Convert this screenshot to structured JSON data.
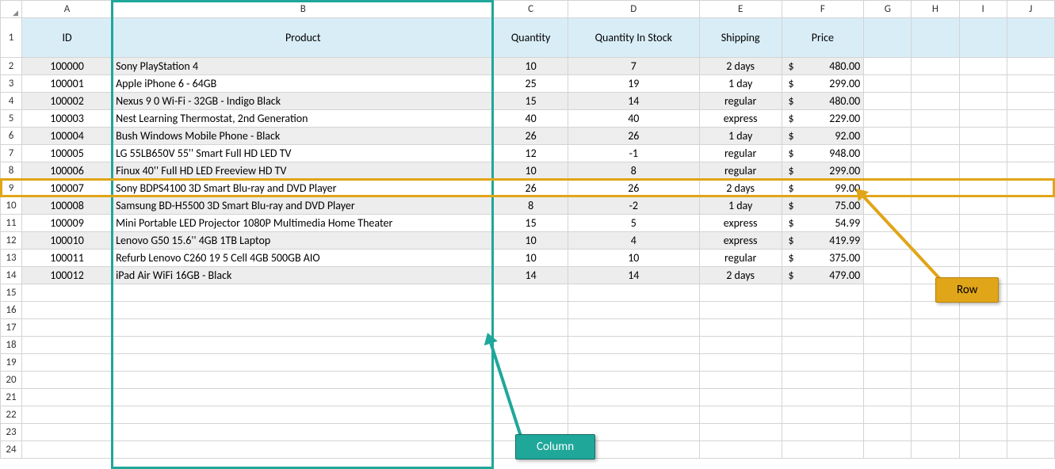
{
  "columns": [
    "A",
    "B",
    "C",
    "D",
    "E",
    "F",
    "G",
    "H",
    "I",
    "J"
  ],
  "col_widths": {
    "row": 26,
    "A": 110,
    "B": 464,
    "C": 90,
    "D": 160,
    "E": 100,
    "F": 100,
    "G": 58,
    "H": 58,
    "I": 58,
    "J": 58
  },
  "headers": {
    "A": "ID",
    "B": "Product",
    "C": "Quantity",
    "D": "Quantity In Stock",
    "E": "Shipping",
    "F": "Price"
  },
  "currency": "$",
  "rows": [
    {
      "A": "100000",
      "B": "Sony PlayStation 4",
      "C": "10",
      "D": "7",
      "E": "2 days",
      "F": "480.00"
    },
    {
      "A": "100001",
      "B": "Apple iPhone 6 - 64GB",
      "C": "25",
      "D": "19",
      "E": "1 day",
      "F": "299.00"
    },
    {
      "A": "100002",
      "B": "Nexus 9 0 Wi-Fi - 32GB - Indigo Black",
      "C": "15",
      "D": "14",
      "E": "regular",
      "F": "480.00"
    },
    {
      "A": "100003",
      "B": "Nest Learning Thermostat, 2nd Generation",
      "C": "40",
      "D": "40",
      "E": "express",
      "F": "229.00"
    },
    {
      "A": "100004",
      "B": "Bush Windows Mobile Phone - Black",
      "C": "26",
      "D": "26",
      "E": "1 day",
      "F": "92.00"
    },
    {
      "A": "100005",
      "B": "LG 55LB650V 55'' Smart Full HD LED TV",
      "C": "12",
      "D": "-1",
      "E": "regular",
      "F": "948.00"
    },
    {
      "A": "100006",
      "B": "Finux 40'' Full HD LED Freeview HD TV",
      "C": "10",
      "D": "8",
      "E": "regular",
      "F": "299.00"
    },
    {
      "A": "100007",
      "B": "Sony BDPS4100 3D Smart Blu-ray and DVD Player",
      "C": "26",
      "D": "26",
      "E": "2 days",
      "F": "99.00"
    },
    {
      "A": "100008",
      "B": "Samsung BD-H5500 3D Smart Blu-ray and DVD Player",
      "C": "8",
      "D": "-2",
      "E": "1 day",
      "F": "75.00"
    },
    {
      "A": "100009",
      "B": "Mini Portable LED Projector 1080P Multimedia Home Theater",
      "C": "15",
      "D": "5",
      "E": "express",
      "F": "54.99"
    },
    {
      "A": "100010",
      "B": "Lenovo G50 15.6'' 4GB 1TB Laptop",
      "C": "10",
      "D": "4",
      "E": "express",
      "F": "419.99"
    },
    {
      "A": "100011",
      "B": "Refurb Lenovo C260 19 5 Cell 4GB 500GB AIO",
      "C": "10",
      "D": "10",
      "E": "regular",
      "F": "375.00"
    },
    {
      "A": "100012",
      "B": "iPad Air WiFi 16GB - Black",
      "C": "14",
      "D": "14",
      "E": "2 days",
      "F": "479.00"
    }
  ],
  "empty_rows": [
    15,
    16,
    17,
    18,
    19,
    20,
    21,
    22,
    23,
    24
  ],
  "annotations": {
    "column_label": "Column",
    "row_label": "Row",
    "highlighted_column": "B",
    "highlighted_row": 9
  }
}
